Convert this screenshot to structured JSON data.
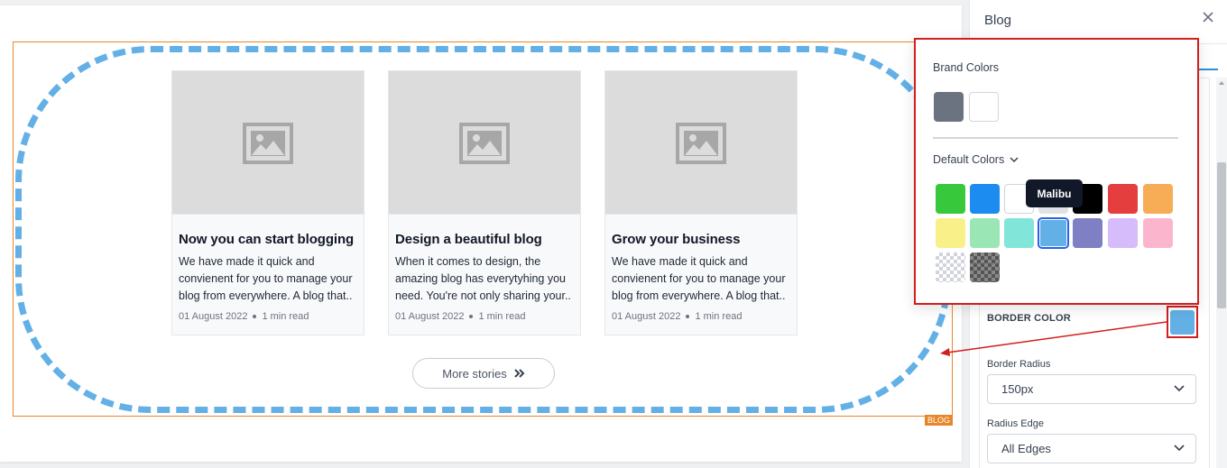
{
  "canvas": {
    "section_tag": "BLOG",
    "posts": [
      {
        "title": "Now you can start blogging",
        "excerpt": "We have made it quick and convienent for you to manage your blog from everywhere. A blog that..",
        "date": "01 August 2022",
        "read_time": "1 min read"
      },
      {
        "title": "Design a beautiful blog",
        "excerpt": "When it comes to design, the amazing blog has everytyhing you need. You're not only sharing your..",
        "date": "01 August 2022",
        "read_time": "1 min read"
      },
      {
        "title": "Grow your business",
        "excerpt": "We have made it quick and convienent for you to manage your blog from everywhere. A blog that..",
        "date": "01 August 2022",
        "read_time": "1 min read"
      }
    ],
    "more_button": "More stories",
    "border_color": "#62b0e6"
  },
  "panel": {
    "title": "Blog",
    "border_color_label": "BORDER COLOR",
    "border_color_value": "#62b0e6",
    "border_radius_label": "Border Radius",
    "border_radius_value": "150px",
    "radius_edge_label": "Radius Edge",
    "radius_edge_value": "All Edges"
  },
  "color_picker": {
    "brand_heading": "Brand Colors",
    "brand_colors": [
      "#6b7280",
      "#ffffff"
    ],
    "default_heading": "Default Colors",
    "default_colors": [
      "#37c93b",
      "#1d8cf0",
      "#ffffff",
      "#dfe3e8",
      "#000000",
      "#e53e3e",
      "#f6ad55",
      "#faf089",
      "#9ae6b4",
      "#81e6d9",
      "#62b0e6",
      "#7f7fc4",
      "#d6bcfa",
      "#fbb6ce"
    ],
    "special_swatches": [
      "transparent",
      "dark-transparent"
    ],
    "selected_color_name": "Malibu"
  }
}
